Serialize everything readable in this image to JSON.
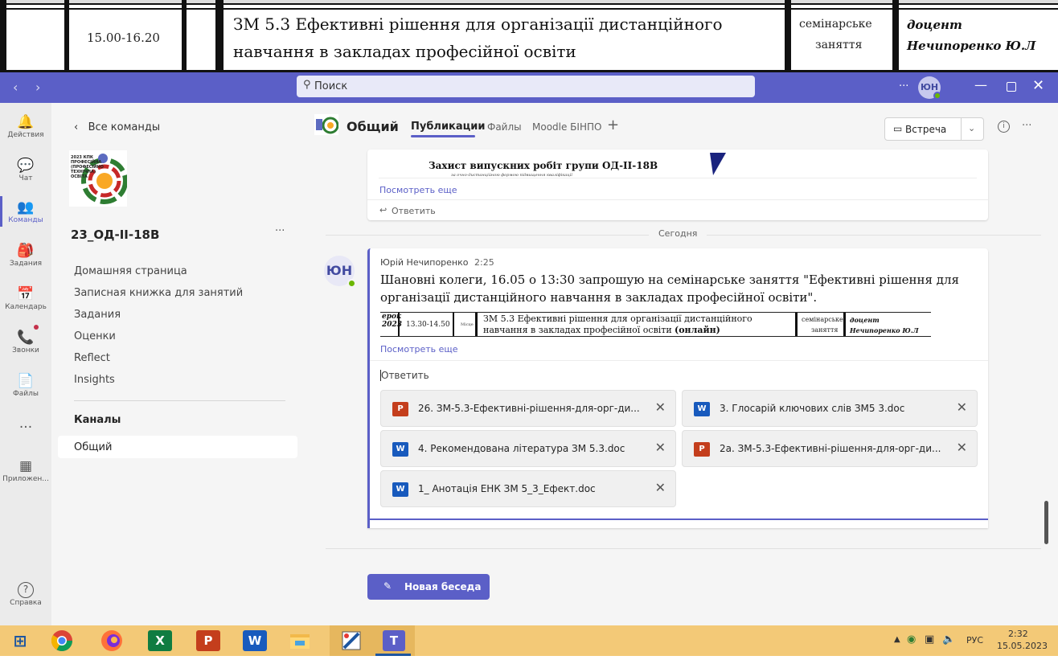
{
  "schedule": {
    "time": "15.00-16.20",
    "title_line1": "ЗМ 5.3 Ефективні рішення для організації дистанційного",
    "title_line2": "навчання в закладах професійної освіти",
    "type_line1": "семінарське",
    "type_line2": "заняття",
    "lecturer_line1": "доцент",
    "lecturer_line2": "Нечипоренко Ю.Л"
  },
  "titlebar": {
    "search_placeholder": "Поиск",
    "more": "···",
    "avatar": "ЮН"
  },
  "rail": [
    {
      "icon": "bell-icon",
      "glyph": "🔔",
      "label": "Действия"
    },
    {
      "icon": "chat-icon",
      "glyph": "💬",
      "label": "Чат"
    },
    {
      "icon": "teams-icon",
      "glyph": "👥",
      "label": "Команды"
    },
    {
      "icon": "assignments-icon",
      "glyph": "🎒",
      "label": "Задания"
    },
    {
      "icon": "calendar-icon",
      "glyph": "📅",
      "label": "Календарь"
    },
    {
      "icon": "calls-icon",
      "glyph": "📞",
      "label": "Звонки"
    },
    {
      "icon": "files-icon",
      "glyph": "📄",
      "label": "Файлы"
    },
    {
      "icon": "more-icon",
      "glyph": "···",
      "label": ""
    },
    {
      "icon": "apps-icon",
      "glyph": "▦",
      "label": "Приложен..."
    }
  ],
  "help": {
    "glyph": "?",
    "label": "Справка"
  },
  "teams_panel": {
    "back": "Все команды",
    "logo_text": "2023 КПК ПРОФЕСІЙНА (ПРОФЕСІЙНО ТЕХНІЧНА) ОСВІТА",
    "team_name": "23_ОД-ІІ-18В",
    "more": "···",
    "nav": [
      "Домашняя страница",
      "Записная книжка для занятий",
      "Задания",
      "Оценки",
      "Reflect",
      "Insights"
    ],
    "channels_header": "Каналы",
    "channel": "Общий"
  },
  "channel_header": {
    "name": "Общий",
    "tabs": [
      "Публикации",
      "Файлы",
      "Moodle БІНПО"
    ],
    "add": "+",
    "meet_label": "Встреча",
    "more": "···"
  },
  "prev_post": {
    "image_title": "Захист випускних робіт групи ОД-ІІ-18В",
    "image_subtitle": "за очно-дистанційною формою підвищення кваліфікації",
    "see_more": "Посмотреть еще",
    "reply": "Ответить"
  },
  "divider": "Сегодня",
  "post": {
    "avatar": "ЮН",
    "author": "Юрій Нечипоренко",
    "time": "2:25",
    "text": "Шановні колеги, 16.05 о 13:30 запрошую на семінарське заняття \"Ефективні рішення для організації дистанційного навчання в закладах професійної освіти\".",
    "embed_day": "ерок 2023",
    "embed_time": "13.30-14.50",
    "embed_room": "Місце",
    "embed_title1": "ЗМ 5.3 Ефективні рішення для організації дистанційного",
    "embed_title2": "навчання в закладах професійної освіти",
    "embed_title2_bold": "(онлайн)",
    "embed_type1": "семінарське",
    "embed_type2": "заняття",
    "embed_lect1": "доцент",
    "embed_lect2": "Нечипоренко Ю.Л",
    "see_more": "Посмотреть еще",
    "reply_placeholder": "Ответить"
  },
  "attachments": [
    {
      "type": "ppt",
      "badge": "P",
      "name": "26. ЗМ-5.3-Ефективні-рішення-для-орг-ди..."
    },
    {
      "type": "doc",
      "badge": "W",
      "name": "3. Глосарій ключових слів ЗМ5 3.doc"
    },
    {
      "type": "doc",
      "badge": "W",
      "name": "4. Рекомендована література ЗМ 5.3.doc"
    },
    {
      "type": "ppt",
      "badge": "P",
      "name": "2а. ЗМ-5.3-Ефективні-рішення-для-орг-ди..."
    },
    {
      "type": "doc",
      "badge": "W",
      "name": "1_ Анотація ЕНК ЗМ 5_3_Ефект.doc"
    }
  ],
  "compose_tools": [
    "format-icon",
    "attach-icon",
    "emoji-icon",
    "gif-icon",
    "sticker-icon",
    "meet-now-icon",
    "video-icon",
    "stream-icon",
    "praise-icon",
    "loop-icon",
    "forms-icon",
    "approvals-icon",
    "more-icon"
  ],
  "new_conversation": "Новая беседа",
  "taskbar": {
    "apps": [
      "windows-start-icon",
      "chrome-icon",
      "firefox-icon",
      "excel-icon",
      "powerpoint-icon",
      "word-icon",
      "file-explorer-icon",
      "paint-icon",
      "teams-icon"
    ],
    "lang": "РУС",
    "time": "2:32",
    "date": "15.05.2023"
  },
  "colors": {
    "brand": "#5b5fc7",
    "taskbar": "#f3c977"
  }
}
